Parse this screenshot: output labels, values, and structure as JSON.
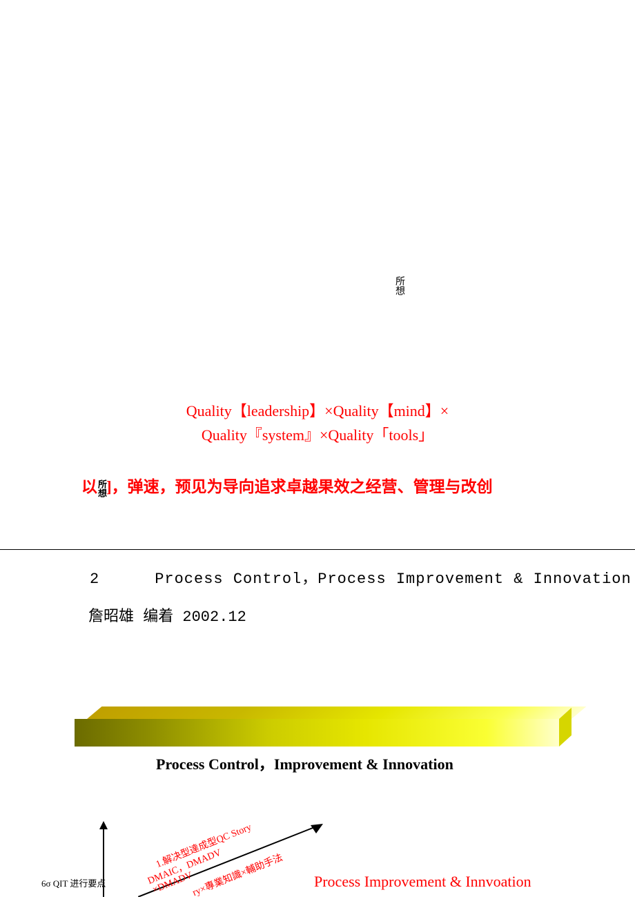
{
  "top_mark": "所想",
  "red": {
    "line1": "Quality【leadership】×Quality【mind】×",
    "line2": "Quality『system』×Quality「tools」",
    "line3_pre": "以",
    "line3_mark": "所想",
    "line3_post": "]，弹速，预见为导向追求卓越果效之经营、管理与改创"
  },
  "section2": {
    "num": "2",
    "title": "Process Control，Process Improvement & Innovation"
  },
  "author": "詹昭雄 编着 2002.12",
  "bar_label": "Process Control，Improvement & Innovation",
  "diag": {
    "t1": "1.解决型達成型QC Story",
    "t2": "DMAIC，DMADV",
    "t3": "×DMADV",
    "t4": "ry×專業知識×輔助手法"
  },
  "footer": "6σ  QIT 进行要点",
  "bottom_red": "Process Improvement & Innvoation"
}
